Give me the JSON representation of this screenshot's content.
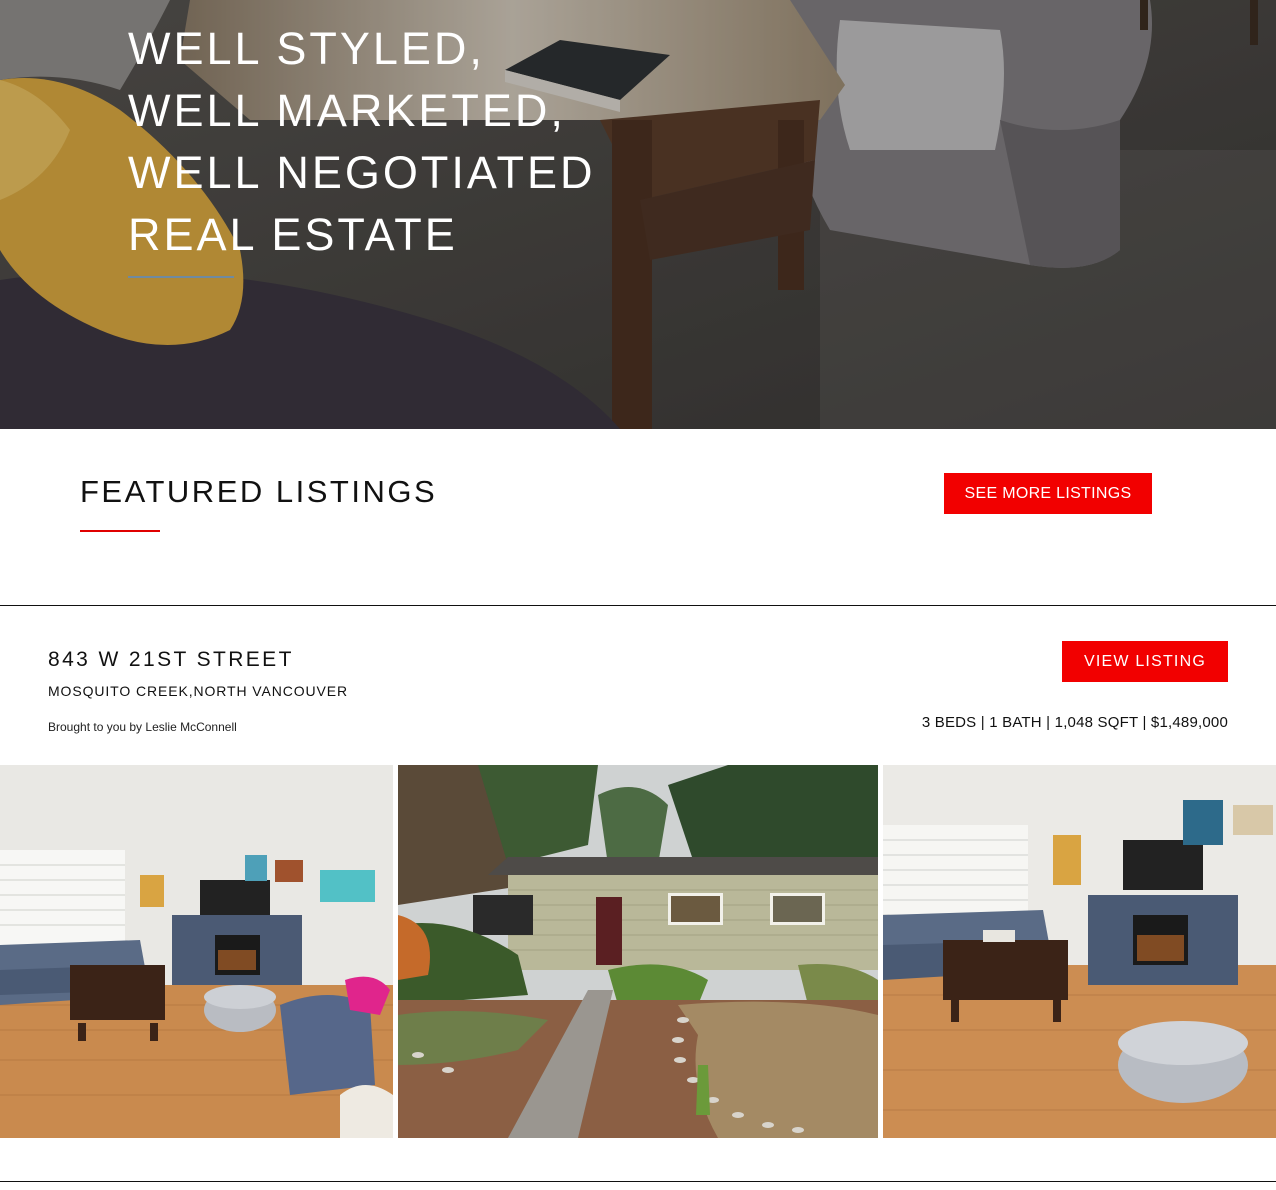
{
  "hero": {
    "title_lines": [
      "WELL STYLED,",
      "WELL MARKETED,",
      "WELL NEGOTIATED",
      "REAL ESTATE"
    ]
  },
  "featured": {
    "title": "FEATURED LISTINGS",
    "see_more_label": "SEE MORE LISTINGS"
  },
  "listing": {
    "address": "843 W 21ST STREET",
    "neighborhood": "MOSQUITO CREEK,NORTH VANCOUVER",
    "byline": "Brought to you by Leslie McConnell",
    "view_label": "VIEW LISTING",
    "stats": "3 BEDS | 1 BATH | 1,048 SQFT | $1,489,000",
    "photos": [
      "living-room-photo",
      "house-exterior-photo",
      "living-room-photo"
    ]
  },
  "colors": {
    "accent": "#f20000",
    "text": "#111111",
    "background": "#ffffff"
  }
}
